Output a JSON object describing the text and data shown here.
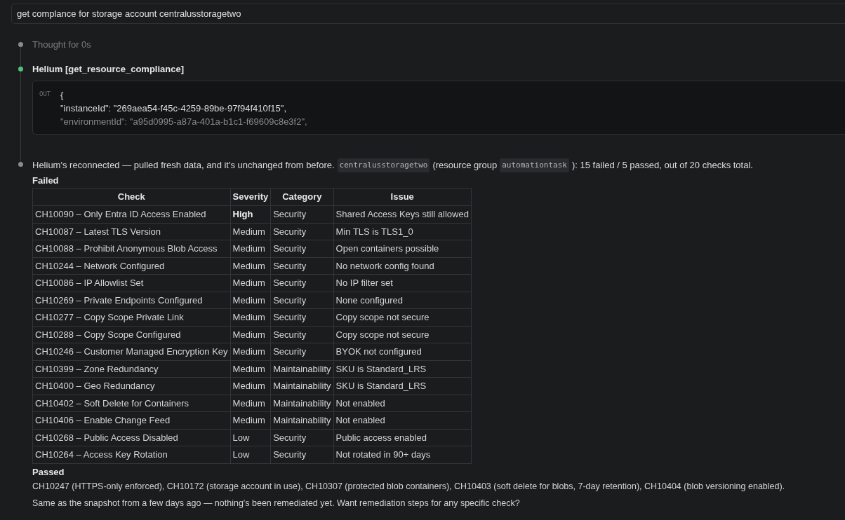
{
  "prompt": {
    "value": "get complance for storage account centralusstoragetwo"
  },
  "steps": [
    {
      "kind": "thought",
      "color": "#8b8b8b",
      "text": "Thought for 0s"
    },
    {
      "kind": "tool",
      "color": "#4fc27a",
      "title": "Helium [get_resource_compliance]",
      "output": {
        "label": "OUT",
        "lines": [
          "{",
          "\"instanceId\": \"269aea54-f45c-4259-89be-97f94f410f15\",",
          "\"environmentId\": \"a95d0995-a87a-401a-b1c1-f69609c8e3f2\","
        ]
      }
    },
    {
      "kind": "message",
      "color": "#8b8b8b",
      "segments": [
        {
          "kind": "text",
          "text": "Helium's reconnected — pulled fresh data, and it's unchanged from before."
        },
        {
          "kind": "code",
          "text": "centralusstoragetwo"
        },
        {
          "kind": "text",
          "text": "(resource group"
        },
        {
          "kind": "code",
          "text": "automationtask"
        },
        {
          "kind": "text",
          "text": "): 15 failed / 5 passed, out of 20 checks total."
        }
      ],
      "failed_heading": "Failed",
      "table": {
        "columns": [
          "Check",
          "Severity",
          "Category",
          "Issue"
        ],
        "rows": [
          {
            "emphasized": true,
            "cells": [
              "CH10090 – Only Entra ID Access Enabled",
              "High",
              "Security",
              "Shared Access Keys still allowed"
            ]
          },
          {
            "emphasized": false,
            "cells": [
              "CH10087 – Latest TLS Version",
              "Medium",
              "Security",
              "Min TLS is TLS1_0"
            ]
          },
          {
            "emphasized": false,
            "cells": [
              "CH10088 – Prohibit Anonymous Blob Access",
              "Medium",
              "Security",
              "Open containers possible"
            ]
          },
          {
            "emphasized": false,
            "cells": [
              "CH10244 – Network Configured",
              "Medium",
              "Security",
              "No network config found"
            ]
          },
          {
            "emphasized": false,
            "cells": [
              "CH10086 – IP Allowlist Set",
              "Medium",
              "Security",
              "No IP filter set"
            ]
          },
          {
            "emphasized": false,
            "cells": [
              "CH10269 – Private Endpoints Configured",
              "Medium",
              "Security",
              "None configured"
            ]
          },
          {
            "emphasized": false,
            "cells": [
              "CH10277 – Copy Scope Private Link",
              "Medium",
              "Security",
              "Copy scope not secure"
            ]
          },
          {
            "emphasized": false,
            "cells": [
              "CH10288 – Copy Scope Configured",
              "Medium",
              "Security",
              "Copy scope not secure"
            ]
          },
          {
            "emphasized": false,
            "cells": [
              "CH10246 – Customer Managed Encryption Key",
              "Medium",
              "Security",
              "BYOK not configured"
            ]
          },
          {
            "emphasized": false,
            "cells": [
              "CH10399 – Zone Redundancy",
              "Medium",
              "Maintainability",
              "SKU is Standard_LRS"
            ]
          },
          {
            "emphasized": false,
            "cells": [
              "CH10400 – Geo Redundancy",
              "Medium",
              "Maintainability",
              "SKU is Standard_LRS"
            ]
          },
          {
            "emphasized": false,
            "cells": [
              "CH10402 – Soft Delete for Containers",
              "Medium",
              "Maintainability",
              "Not enabled"
            ]
          },
          {
            "emphasized": false,
            "cells": [
              "CH10406 – Enable Change Feed",
              "Medium",
              "Maintainability",
              "Not enabled"
            ]
          },
          {
            "emphasized": false,
            "cells": [
              "CH10268 – Public Access Disabled",
              "Low",
              "Security",
              "Public access enabled"
            ]
          },
          {
            "emphasized": false,
            "cells": [
              "CH10264 – Access Key Rotation",
              "Low",
              "Security",
              "Not rotated in 90+ days"
            ]
          }
        ]
      },
      "passed_heading": "Passed",
      "passed_text": "CH10247 (HTTPS-only enforced), CH10172 (storage account in use), CH10307 (protected blob containers), CH10403 (soft delete for blobs, 7-day retention), CH10404 (blob versioning enabled).",
      "closing": "Same as the snapshot from a few days ago — nothing's been remediated yet. Want remediation steps for any specific check?"
    }
  ]
}
